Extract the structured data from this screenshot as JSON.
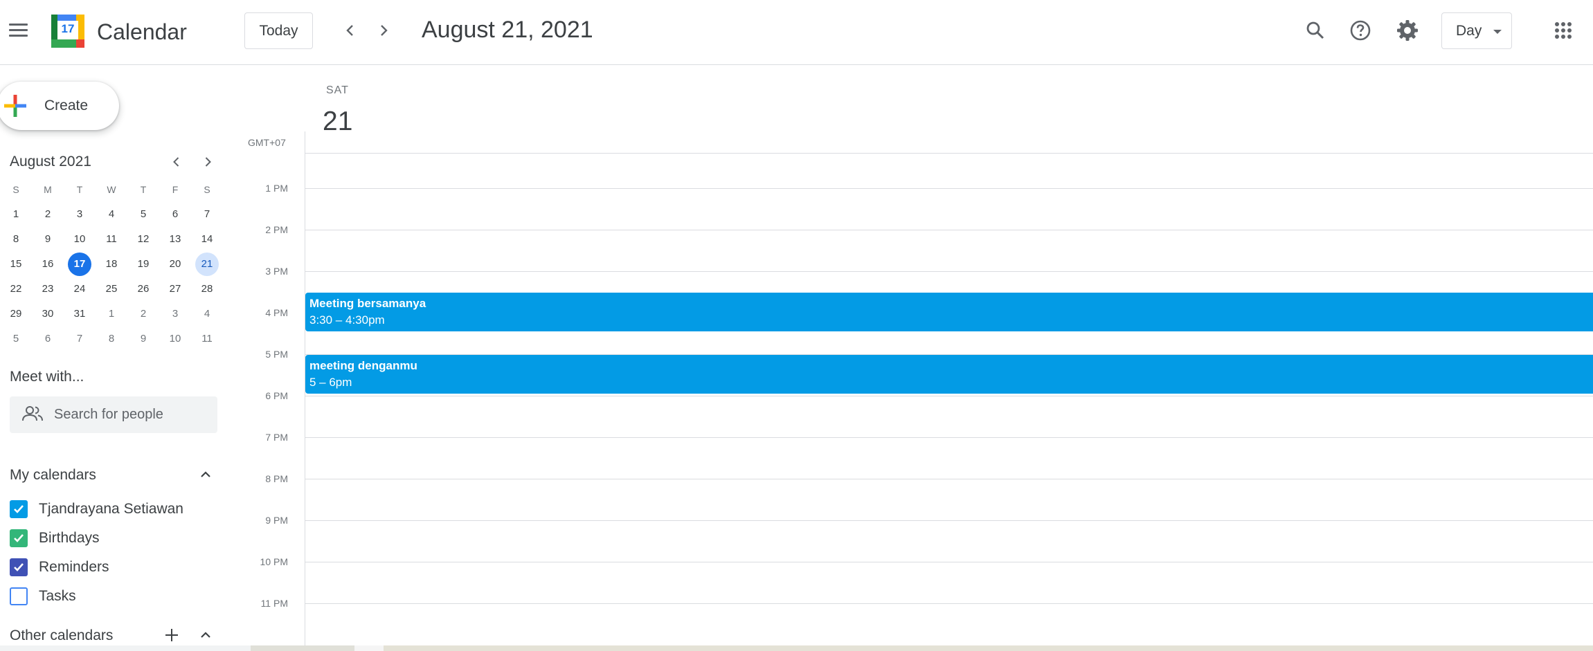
{
  "header": {
    "logo_day": "17",
    "app_title": "Calendar",
    "today_label": "Today",
    "date_title": "August 21, 2021",
    "view_label": "Day"
  },
  "sidebar": {
    "create_label": "Create",
    "mini_calendar": {
      "title": "August 2021",
      "weekdays": [
        "S",
        "M",
        "T",
        "W",
        "T",
        "F",
        "S"
      ],
      "weeks": [
        [
          "1",
          "2",
          "3",
          "4",
          "5",
          "6",
          "7"
        ],
        [
          "8",
          "9",
          "10",
          "11",
          "12",
          "13",
          "14"
        ],
        [
          "15",
          "16",
          "17",
          "18",
          "19",
          "20",
          "21"
        ],
        [
          "22",
          "23",
          "24",
          "25",
          "26",
          "27",
          "28"
        ],
        [
          "29",
          "30",
          "31",
          "1",
          "2",
          "3",
          "4"
        ],
        [
          "5",
          "6",
          "7",
          "8",
          "9",
          "10",
          "11"
        ]
      ],
      "today": "17",
      "selected": "21"
    },
    "meet_title": "Meet with...",
    "people_search_placeholder": "Search for people",
    "my_calendars_title": "My calendars",
    "my_calendars": [
      {
        "name": "Tjandrayana Setiawan",
        "color": "#039be5",
        "checked": true
      },
      {
        "name": "Birthdays",
        "color": "#33b679",
        "checked": true
      },
      {
        "name": "Reminders",
        "color": "#3f51b5",
        "checked": true
      },
      {
        "name": "Tasks",
        "color": "#4285f4",
        "checked": false
      }
    ],
    "other_calendars_title": "Other calendars"
  },
  "day_view": {
    "day_name": "SAT",
    "day_number": "21",
    "timezone": "GMT+07",
    "hours": [
      "1 PM",
      "2 PM",
      "3 PM",
      "4 PM",
      "5 PM",
      "6 PM",
      "7 PM",
      "8 PM",
      "9 PM",
      "10 PM",
      "11 PM"
    ],
    "events": [
      {
        "title": "Meeting bersamanya",
        "time": "3:30 – 4:30pm",
        "color": "#039be5"
      },
      {
        "title": "meeting denganmu",
        "time": "5 – 6pm",
        "color": "#039be5"
      }
    ]
  }
}
